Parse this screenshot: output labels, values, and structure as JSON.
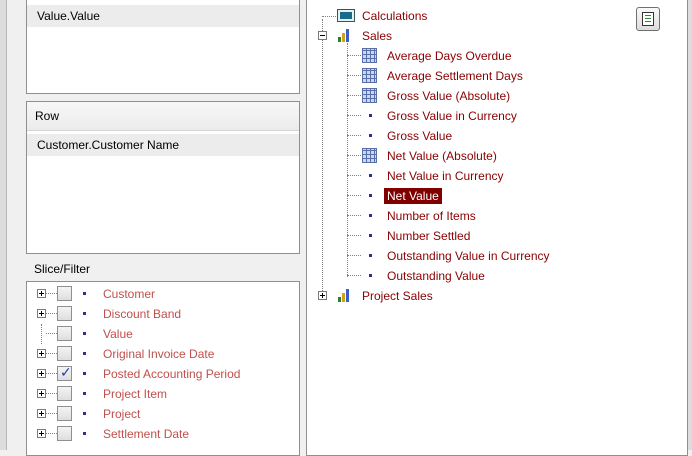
{
  "value_panel": {
    "items": [
      "Value.Value"
    ]
  },
  "row_panel": {
    "header": "Row",
    "items": [
      "Customer.Customer Name"
    ]
  },
  "slice_filter": {
    "label": "Slice/Filter",
    "items": [
      {
        "label": "Customer",
        "checked": false,
        "expandable": true
      },
      {
        "label": "Discount Band",
        "checked": false,
        "expandable": true
      },
      {
        "label": "Value",
        "checked": false,
        "expandable": false
      },
      {
        "label": "Original Invoice Date",
        "checked": false,
        "expandable": true
      },
      {
        "label": "Posted Accounting Period",
        "checked": true,
        "expandable": true
      },
      {
        "label": "Project Item",
        "checked": false,
        "expandable": true
      },
      {
        "label": "Project",
        "checked": false,
        "expandable": true
      },
      {
        "label": "Settlement Date",
        "checked": false,
        "expandable": true
      }
    ]
  },
  "tree": {
    "calculations": "Calculations",
    "sales": {
      "label": "Sales",
      "children": [
        {
          "label": "Average Days Overdue",
          "icon": "grid-icon"
        },
        {
          "label": "Average Settlement Days",
          "icon": "grid-icon"
        },
        {
          "label": "Gross Value (Absolute)",
          "icon": "grid-icon"
        },
        {
          "label": "Gross Value in Currency",
          "icon": "dot"
        },
        {
          "label": "Gross Value",
          "icon": "dot"
        },
        {
          "label": "Net Value (Absolute)",
          "icon": "grid-icon"
        },
        {
          "label": "Net Value in Currency",
          "icon": "dot"
        },
        {
          "label": "Net Value",
          "icon": "dot",
          "selected": true
        },
        {
          "label": "Number of Items",
          "icon": "dot"
        },
        {
          "label": "Number Settled",
          "icon": "dot"
        },
        {
          "label": "Outstanding Value in Currency",
          "icon": "dot"
        },
        {
          "label": "Outstanding Value",
          "icon": "dot"
        }
      ]
    },
    "project_sales": "Project Sales"
  },
  "colors": {
    "measure_text": "#8b0000",
    "selected_bg": "#800000",
    "dimension_text": "#c0504d"
  }
}
